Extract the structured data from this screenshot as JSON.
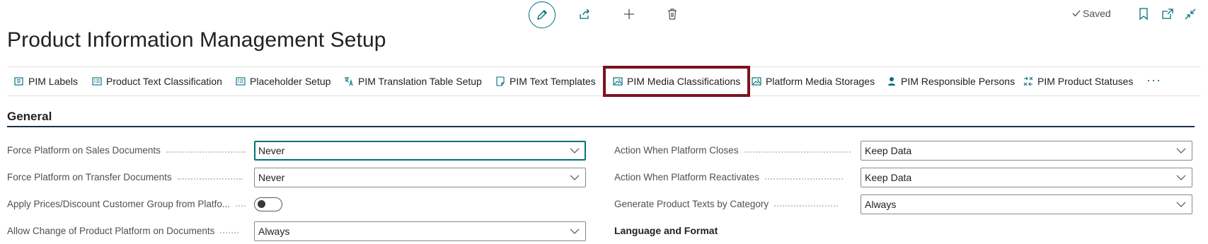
{
  "page": {
    "title": "Product Information Management Setup"
  },
  "top_bar": {
    "saved_label": "Saved",
    "icons": [
      "edit-icon",
      "share-icon",
      "add-icon",
      "delete-icon",
      "bookmark-icon",
      "open-new-window-icon",
      "collapse-icon"
    ]
  },
  "actions": [
    {
      "label": "PIM Labels",
      "icon": "labels-icon"
    },
    {
      "label": "Product Text Classification",
      "icon": "list-icon"
    },
    {
      "label": "Placeholder Setup",
      "icon": "list-icon"
    },
    {
      "label": "PIM Translation Table Setup",
      "icon": "translate-icon"
    },
    {
      "label": "PIM Text Templates",
      "icon": "template-icon"
    },
    {
      "label": "PIM Media Classifications",
      "icon": "image-icon"
    },
    {
      "label": "Platform Media Storages",
      "icon": "image-icon"
    },
    {
      "label": "PIM Responsible Persons",
      "icon": "person-icon"
    },
    {
      "label": "PIM Product Statuses",
      "icon": "status-icon"
    }
  ],
  "more_label": "···",
  "section": {
    "title": "General",
    "left_fields": [
      {
        "label": "Force Platform on Sales Documents",
        "value": "Never"
      },
      {
        "label": "Force Platform on Transfer Documents",
        "value": "Never"
      },
      {
        "label": "Apply Prices/Discount Customer Group from Platfo...",
        "value": "off"
      },
      {
        "label": "Allow Change of Product Platform on Documents",
        "value": "Always"
      }
    ],
    "right_fields": [
      {
        "label": "Action When Platform Closes",
        "value": "Keep Data"
      },
      {
        "label": "Action When Platform Reactivates",
        "value": "Keep Data"
      },
      {
        "label": "Generate Product Texts by Category",
        "value": "Always"
      }
    ],
    "subheading": "Language and Format"
  },
  "colors": {
    "accent": "#00707a",
    "highlight_border": "#7b1420",
    "section_line": "#1c3047"
  }
}
